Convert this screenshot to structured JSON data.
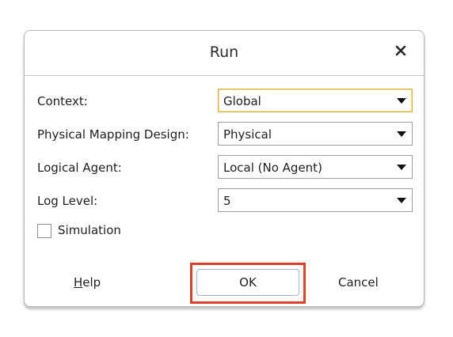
{
  "dialog": {
    "title": "Run",
    "close_icon": "close-icon"
  },
  "fields": [
    {
      "label": "Context:",
      "value": "Global"
    },
    {
      "label": "Physical Mapping Design:",
      "value": "Physical"
    },
    {
      "label": "Logical Agent:",
      "value": "Local (No Agent)"
    },
    {
      "label": "Log Level:",
      "value": "5"
    }
  ],
  "simulation": {
    "label": "Simulation",
    "checked": false
  },
  "buttons": {
    "help_mnemonic": "H",
    "help_rest": "elp",
    "ok": "OK",
    "cancel": "Cancel"
  },
  "colors": {
    "highlight": "#d9412b",
    "focus_border": "#d4b24a"
  }
}
